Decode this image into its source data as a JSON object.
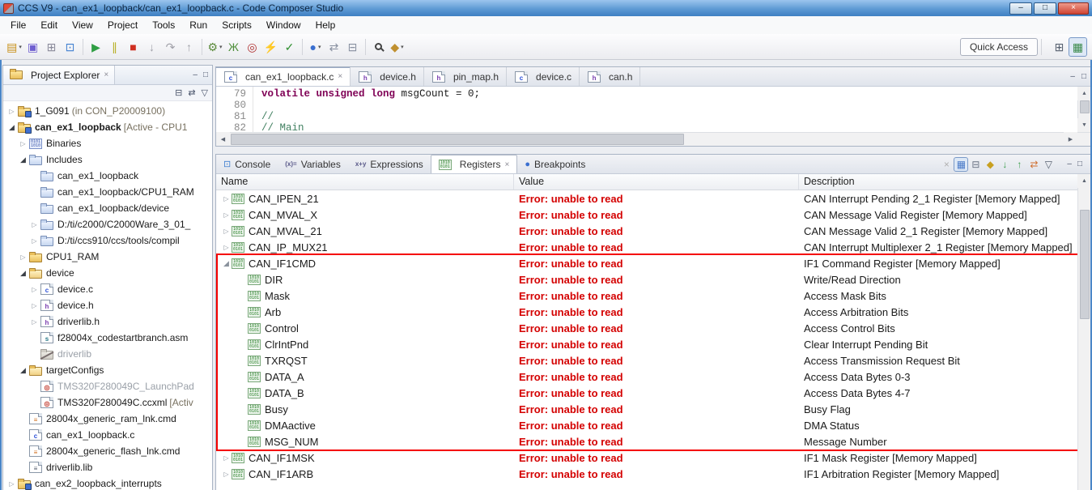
{
  "window": {
    "title": "CCS V9 - can_ex1_loopback/can_ex1_loopback.c - Code Composer Studio"
  },
  "glyphs": {
    "collapsed": "▷",
    "expanded": "◢",
    "minimize": "–",
    "maximize": "□",
    "close": "×",
    "up": "▲",
    "down": "▼",
    "left": "◀",
    "right": "▶",
    "menu": "▽",
    "collapse_all": "⊟",
    "link_editor": "⇄"
  },
  "menu": [
    "File",
    "Edit",
    "View",
    "Project",
    "Tools",
    "Run",
    "Scripts",
    "Window",
    "Help"
  ],
  "toolbar": {
    "quick_access": "Quick Access",
    "icons": [
      {
        "name": "new",
        "glyph": "▤",
        "color": "#c89018",
        "dropdown": true
      },
      {
        "name": "save",
        "glyph": "▣",
        "color": "#6f5fd0"
      },
      {
        "name": "save-all",
        "glyph": "⊞",
        "color": "#8a8a9a"
      },
      {
        "name": "show-console",
        "glyph": "⊡",
        "color": "#3f7fd0"
      },
      {
        "sep": true
      },
      {
        "name": "resume",
        "glyph": "▶",
        "color": "#2f9e44"
      },
      {
        "name": "suspend",
        "glyph": "∥",
        "color": "#b8b028"
      },
      {
        "name": "terminate",
        "glyph": "■",
        "color": "#cf2f21"
      },
      {
        "name": "step-into",
        "glyph": "↓",
        "color": "#a0a0a8"
      },
      {
        "name": "step-over",
        "glyph": "↷",
        "color": "#a0a0a8"
      },
      {
        "name": "step-return",
        "glyph": "↑",
        "color": "#a0a0a8"
      },
      {
        "sep": true
      },
      {
        "name": "build",
        "glyph": "⚙",
        "color": "#5a8a3a",
        "dropdown": true
      },
      {
        "name": "debug",
        "glyph": "Ж",
        "color": "#4e8f3a"
      },
      {
        "name": "new-target-configuration",
        "glyph": "◎",
        "color": "#b03030"
      },
      {
        "name": "flash",
        "glyph": "⚡",
        "color": "#d09020"
      },
      {
        "name": "verify",
        "glyph": "✓",
        "color": "#2f8f2f"
      },
      {
        "sep": true
      },
      {
        "name": "toggle-breakpoint",
        "glyph": "●",
        "color": "#3a6fd0",
        "dropdown": true
      },
      {
        "name": "sync",
        "glyph": "⇄",
        "color": "#8890a0"
      },
      {
        "name": "reset-views",
        "glyph": "⊟",
        "color": "#8890a0"
      },
      {
        "sep": true
      },
      {
        "name": "search",
        "shape": "magnifier"
      },
      {
        "name": "trace",
        "glyph": "◆",
        "color": "#c09030",
        "dropdown": true
      }
    ],
    "right_icons": [
      {
        "name": "open-perspective",
        "glyph": "⊞",
        "color": "#555f6e"
      },
      {
        "name": "ccs-edit-perspective",
        "glyph": "▦",
        "color": "#3a8a4a",
        "pressed": true
      }
    ]
  },
  "project_explorer": {
    "title": "Project Explorer",
    "items": [
      {
        "label": "1_G091",
        "suffix": "(in CON_P20009100)",
        "depth": 0,
        "expander": "collapsed",
        "icon": "project"
      },
      {
        "label": "can_ex1_loopback",
        "suffix": "[Active - CPU1",
        "depth": 0,
        "expander": "expanded",
        "icon": "project",
        "bold": true
      },
      {
        "label": "Binaries",
        "depth": 1,
        "expander": "collapsed",
        "icon": "binaries"
      },
      {
        "label": "Includes",
        "depth": 1,
        "expander": "expanded",
        "icon": "includes"
      },
      {
        "label": "can_ex1_loopback",
        "depth": 2,
        "icon": "incdir"
      },
      {
        "label": "can_ex1_loopback/CPU1_RAM",
        "depth": 2,
        "icon": "incdir"
      },
      {
        "label": "can_ex1_loopback/device",
        "depth": 2,
        "icon": "incdir"
      },
      {
        "label": "D:/ti/c2000/C2000Ware_3_01_",
        "depth": 2,
        "expander": "collapsed",
        "icon": "incdir"
      },
      {
        "label": "D:/ti/ccs910/ccs/tools/compil",
        "depth": 2,
        "expander": "collapsed",
        "icon": "incdir"
      },
      {
        "label": "CPU1_RAM",
        "depth": 1,
        "expander": "collapsed",
        "icon": "folder"
      },
      {
        "label": "device",
        "depth": 1,
        "expander": "expanded",
        "icon": "folder-open"
      },
      {
        "label": "device.c",
        "depth": 2,
        "expander": "collapsed",
        "icon": "c-file"
      },
      {
        "label": "device.h",
        "depth": 2,
        "expander": "collapsed",
        "icon": "h-file"
      },
      {
        "label": "driverlib.h",
        "depth": 2,
        "expander": "collapsed",
        "icon": "h-file"
      },
      {
        "label": "f28004x_codestartbranch.asm",
        "depth": 2,
        "icon": "asm-file"
      },
      {
        "label": "driverlib",
        "depth": 2,
        "icon": "folder-x",
        "gray": true
      },
      {
        "label": "targetConfigs",
        "depth": 1,
        "expander": "expanded",
        "icon": "folder-open"
      },
      {
        "label": "TMS320F280049C_LaunchPad",
        "depth": 2,
        "icon": "ccxml",
        "gray": true
      },
      {
        "label": "TMS320F280049C.ccxml",
        "suffix": "[Activ",
        "depth": 2,
        "icon": "ccxml"
      },
      {
        "label": "28004x_generic_ram_lnk.cmd",
        "depth": 1,
        "icon": "cmd-file"
      },
      {
        "label": "can_ex1_loopback.c",
        "depth": 1,
        "icon": "c-file"
      },
      {
        "label": "28004x_generic_flash_lnk.cmd",
        "depth": 1,
        "icon": "cmd-file"
      },
      {
        "label": "driverlib.lib",
        "depth": 1,
        "icon": "lib-file"
      },
      {
        "label": "can_ex2_loopback_interrupts",
        "depth": 0,
        "expander": "collapsed",
        "icon": "project"
      }
    ]
  },
  "editor": {
    "tabs": [
      {
        "label": "can_ex1_loopback.c",
        "icon": "c-file",
        "active": true
      },
      {
        "label": "device.h",
        "icon": "h-file"
      },
      {
        "label": "pin_map.h",
        "icon": "h-file"
      },
      {
        "label": "device.c",
        "icon": "c-file"
      },
      {
        "label": "can.h",
        "icon": "h-file"
      }
    ],
    "lines": [
      {
        "num": "79",
        "segs": [
          {
            "t": "kw",
            "s": "volatile unsigned long"
          },
          {
            "t": "p",
            "s": " msgCount = 0;"
          }
        ]
      },
      {
        "num": "80",
        "segs": []
      },
      {
        "num": "81",
        "segs": [
          {
            "t": "c",
            "s": "//"
          }
        ]
      },
      {
        "num": "82",
        "segs": [
          {
            "t": "c",
            "s": "// Main"
          }
        ]
      }
    ]
  },
  "bottom_panel": {
    "tabs": [
      {
        "label": "Console",
        "icon": "console",
        "glyph": "⊡",
        "color": "#3f7fd0"
      },
      {
        "label": "Variables",
        "icon": "variables",
        "icon_text": "(x)="
      },
      {
        "label": "Expressions",
        "icon": "expressions",
        "icon_text": "x+y"
      },
      {
        "label": "Registers",
        "icon": "registers",
        "active": true
      },
      {
        "label": "Breakpoints",
        "icon": "breakpoints",
        "glyph": "●",
        "color": "#3a6fd0"
      }
    ],
    "toolbar": [
      {
        "name": "remove-all",
        "glyph": "×",
        "color": "#b0b0b0"
      },
      {
        "name": "show-as-table",
        "glyph": "▦",
        "color": "#4a7ac8",
        "pressed": true
      },
      {
        "name": "collapse-all",
        "glyph": "⊟",
        "color": "#667080"
      },
      {
        "name": "pin-view",
        "glyph": "◆",
        "color": "#c8a020"
      },
      {
        "name": "import-registers",
        "glyph": "↓",
        "color": "#3a9d4a"
      },
      {
        "name": "export-registers",
        "glyph": "↑",
        "color": "#3a9d4a"
      },
      {
        "name": "refresh",
        "glyph": "⇄",
        "color": "#d07030"
      },
      {
        "name": "view-menu",
        "glyph": "▽",
        "color": "#555f6e"
      }
    ],
    "columns": [
      "Name",
      "Value",
      "Description"
    ],
    "rows": [
      {
        "name": "CAN_IPEN_21",
        "value": "Error: unable to read",
        "desc": "CAN Interrupt Pending 2_1 Register [Memory Mapped]",
        "level": 0,
        "expander": "collapsed"
      },
      {
        "name": "CAN_MVAL_X",
        "value": "Error: unable to read",
        "desc": "CAN Message Valid Register [Memory Mapped]",
        "level": 0,
        "expander": "collapsed"
      },
      {
        "name": "CAN_MVAL_21",
        "value": "Error: unable to read",
        "desc": "CAN Message Valid 2_1 Register [Memory Mapped]",
        "level": 0,
        "expander": "collapsed"
      },
      {
        "name": "CAN_IP_MUX21",
        "value": "Error: unable to read",
        "desc": "CAN Interrupt Multiplexer 2_1 Register [Memory Mapped]",
        "level": 0,
        "expander": "collapsed"
      },
      {
        "name": "CAN_IF1CMD",
        "value": "Error: unable to read",
        "desc": "IF1 Command Register [Memory Mapped]",
        "level": 0,
        "expander": "expanded"
      },
      {
        "name": "DIR",
        "value": "Error: unable to read",
        "desc": "Write/Read Direction",
        "level": 1
      },
      {
        "name": "Mask",
        "value": "Error: unable to read",
        "desc": "Access Mask Bits",
        "level": 1
      },
      {
        "name": "Arb",
        "value": "Error: unable to read",
        "desc": "Access Arbitration Bits",
        "level": 1
      },
      {
        "name": "Control",
        "value": "Error: unable to read",
        "desc": "Access Control Bits",
        "level": 1
      },
      {
        "name": "ClrIntPnd",
        "value": "Error: unable to read",
        "desc": "Clear Interrupt Pending Bit",
        "level": 1
      },
      {
        "name": "TXRQST",
        "value": "Error: unable to read",
        "desc": "Access Transmission Request Bit",
        "level": 1
      },
      {
        "name": "DATA_A",
        "value": "Error: unable to read",
        "desc": "Access Data Bytes 0-3",
        "level": 1
      },
      {
        "name": "DATA_B",
        "value": "Error: unable to read",
        "desc": "Access Data Bytes 4-7",
        "level": 1
      },
      {
        "name": "Busy",
        "value": "Error: unable to read",
        "desc": "Busy Flag",
        "level": 1
      },
      {
        "name": "DMAactive",
        "value": "Error: unable to read",
        "desc": "DMA Status",
        "level": 1
      },
      {
        "name": "MSG_NUM",
        "value": "Error: unable to read",
        "desc": "Message Number",
        "level": 1
      },
      {
        "name": "CAN_IF1MSK",
        "value": "Error: unable to read",
        "desc": "IF1 Mask Register [Memory Mapped]",
        "level": 0,
        "expander": "collapsed"
      },
      {
        "name": "CAN_IF1ARB",
        "value": "Error: unable to read",
        "desc": "IF1 Arbitration Register [Memory Mapped]",
        "level": 0,
        "expander": "collapsed"
      }
    ],
    "highlight": {
      "first_row": "CAN_IF1CMD",
      "last_row": "MSG_NUM"
    }
  },
  "colors": {
    "error": "#d40000",
    "highlight": "#f50000",
    "keyword": "#7f0055",
    "comment": "#3f7f5f",
    "titlebar_blue": "#5e9ad4"
  }
}
